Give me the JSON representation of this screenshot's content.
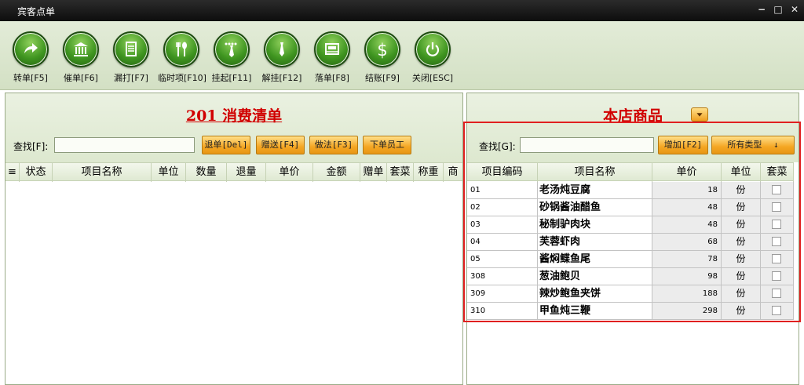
{
  "window": {
    "title": "宾客点单",
    "min": "−",
    "max": "□",
    "close": "✕"
  },
  "toolbar": [
    {
      "id": "transfer",
      "label": "转单[F5]"
    },
    {
      "id": "urge",
      "label": "催单[F6]"
    },
    {
      "id": "reprint",
      "label": "漏打[F7]"
    },
    {
      "id": "temp",
      "label": "临时项[F10]"
    },
    {
      "id": "hang",
      "label": "挂起[F11]"
    },
    {
      "id": "unhang",
      "label": "解挂[F12]"
    },
    {
      "id": "place",
      "label": "落单[F8]"
    },
    {
      "id": "checkout",
      "label": "结账[F9]"
    },
    {
      "id": "close",
      "label": "关闭[ESC]"
    }
  ],
  "left": {
    "title": "201 消费清单",
    "search_label": "查找[F]:",
    "search_value": "",
    "buttons": {
      "return": "退单[Del]",
      "gift": "赠送[F4]",
      "method": "做法[F3]",
      "staff": "下单员工"
    },
    "columns": [
      "≡",
      "状态",
      "项目名称",
      "单位",
      "数量",
      "退量",
      "单价",
      "金额",
      "赠单",
      "套菜",
      "称重",
      "商"
    ]
  },
  "right": {
    "title": "本店商品",
    "search_label": "查找[G]:",
    "search_value": "",
    "add_button": "增加[F2]",
    "type_select": "所有类型",
    "type_arrow": "↓",
    "columns": [
      "项目编码",
      "项目名称",
      "单价",
      "单位",
      "套菜"
    ],
    "rows": [
      {
        "code": "01",
        "name": "老汤炖豆腐",
        "price": "18",
        "unit": "份"
      },
      {
        "code": "02",
        "name": "砂锅酱油醋鱼",
        "price": "48",
        "unit": "份"
      },
      {
        "code": "03",
        "name": "秘制驴肉块",
        "price": "48",
        "unit": "份"
      },
      {
        "code": "04",
        "name": "芙蓉虾肉",
        "price": "68",
        "unit": "份"
      },
      {
        "code": "05",
        "name": "酱焖鲽鱼尾",
        "price": "78",
        "unit": "份"
      },
      {
        "code": "308",
        "name": "葱油鲍贝",
        "price": "98",
        "unit": "份"
      },
      {
        "code": "309",
        "name": "辣炒鲍鱼夹饼",
        "price": "188",
        "unit": "份"
      },
      {
        "code": "310",
        "name": "甲鱼炖三鞭",
        "price": "298",
        "unit": "份"
      }
    ]
  }
}
